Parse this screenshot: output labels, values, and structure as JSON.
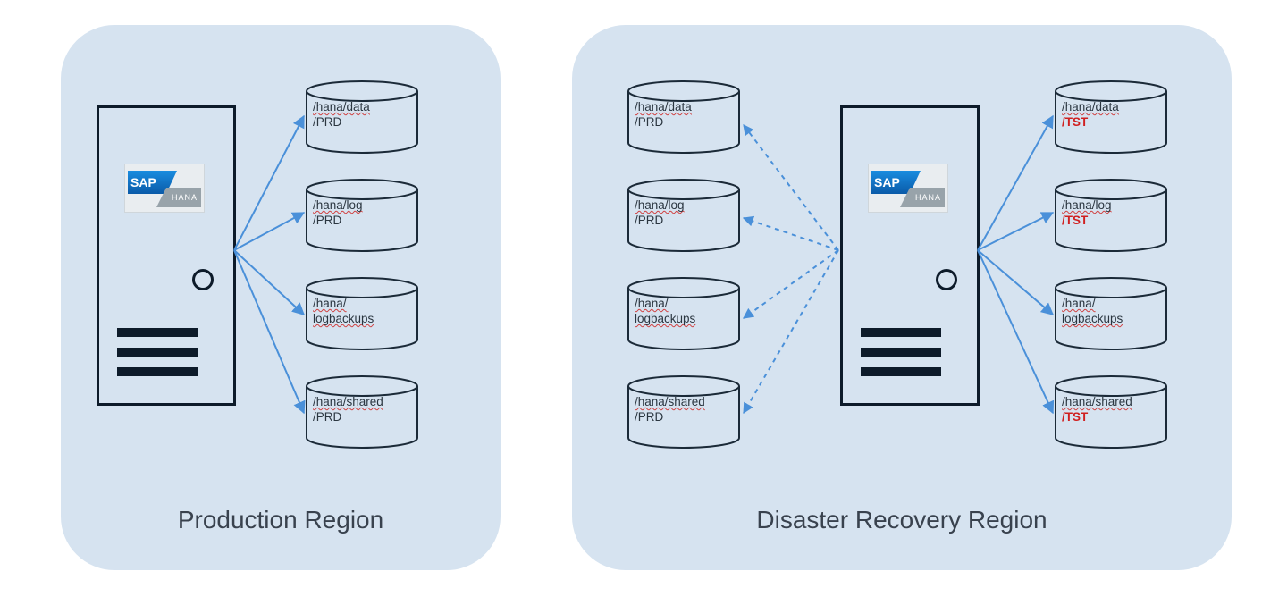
{
  "regions": {
    "prod": {
      "title": "Production Region"
    },
    "dr": {
      "title": "Disaster Recovery Region"
    }
  },
  "logo": {
    "sap": "SAP",
    "hana": "HANA"
  },
  "paths": {
    "data": {
      "l1": "/hana/data",
      "l2": "/PRD"
    },
    "log": {
      "l1": "/hana/log",
      "l2": "/PRD"
    },
    "logbackups": {
      "l1": "/hana/",
      "l2": "logbackups"
    },
    "shared": {
      "l1": "/hana/shared",
      "l2": "/PRD"
    },
    "data_tst": {
      "l1": "/hana/data",
      "l2": "/TST"
    },
    "log_tst": {
      "l1": "/hana/log",
      "l2": "/TST"
    },
    "shared_tst": {
      "l1": "/hana/shared",
      "l2": "/TST"
    }
  }
}
